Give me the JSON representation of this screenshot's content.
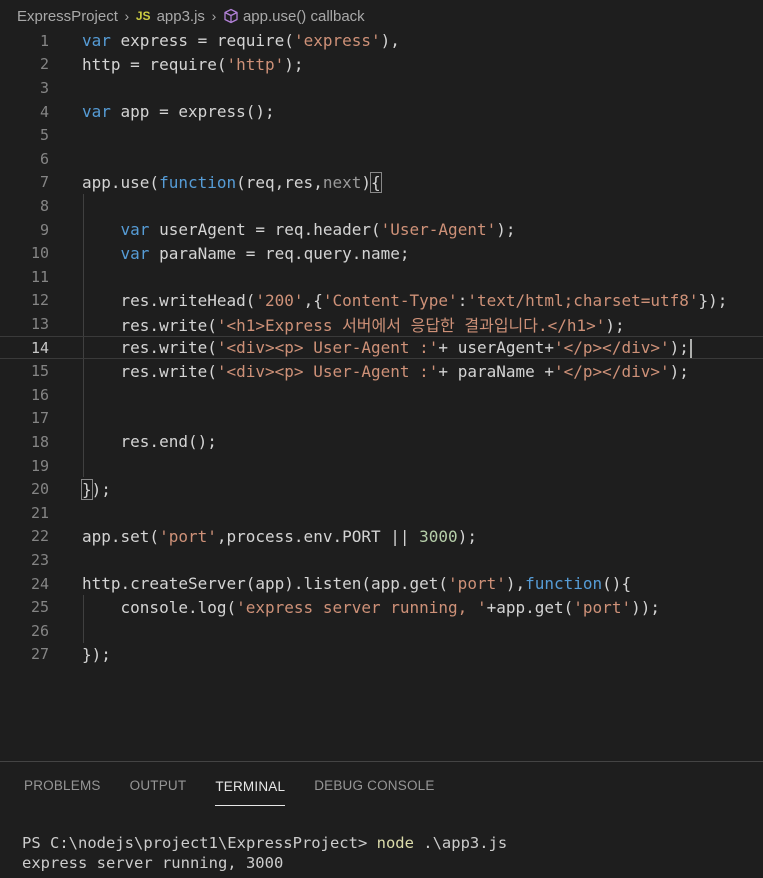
{
  "breadcrumb": {
    "project": "ExpressProject",
    "file_icon": "JS",
    "file": "app3.js",
    "symbol_icon": "cube-icon",
    "symbol": "app.use() callback"
  },
  "editor": {
    "active_line": 14,
    "lines": [
      {
        "n": "1"
      },
      {
        "n": "2"
      },
      {
        "n": "3"
      },
      {
        "n": "4"
      },
      {
        "n": "5"
      },
      {
        "n": "6"
      },
      {
        "n": "7"
      },
      {
        "n": "8"
      },
      {
        "n": "9"
      },
      {
        "n": "10"
      },
      {
        "n": "11"
      },
      {
        "n": "12"
      },
      {
        "n": "13"
      },
      {
        "n": "14"
      },
      {
        "n": "15"
      },
      {
        "n": "16"
      },
      {
        "n": "17"
      },
      {
        "n": "18"
      },
      {
        "n": "19"
      },
      {
        "n": "20"
      },
      {
        "n": "21"
      },
      {
        "n": "22"
      },
      {
        "n": "23"
      },
      {
        "n": "24"
      },
      {
        "n": "25"
      },
      {
        "n": "26"
      },
      {
        "n": "27"
      }
    ],
    "code": [
      [
        [
          "kw",
          "var"
        ],
        [
          "plain",
          " express = require("
        ],
        [
          "str",
          "'express'"
        ],
        [
          "plain",
          "),"
        ]
      ],
      [
        [
          "plain",
          "http = require("
        ],
        [
          "str",
          "'http'"
        ],
        [
          "plain",
          ");"
        ]
      ],
      [],
      [
        [
          "kw",
          "var"
        ],
        [
          "plain",
          " app = express();"
        ]
      ],
      [],
      [],
      [
        [
          "plain",
          "app.use("
        ],
        [
          "kw",
          "function"
        ],
        [
          "plain",
          "(req,res,"
        ],
        [
          "dim",
          "next"
        ],
        [
          "plain",
          ")"
        ],
        [
          "plain",
          "{"
        ]
      ],
      [],
      [
        [
          "plain",
          "    "
        ],
        [
          "kw",
          "var"
        ],
        [
          "plain",
          " userAgent = req.header("
        ],
        [
          "str",
          "'User-Agent'"
        ],
        [
          "plain",
          ");"
        ]
      ],
      [
        [
          "plain",
          "    "
        ],
        [
          "kw",
          "var"
        ],
        [
          "plain",
          " paraName = req.query.name;"
        ]
      ],
      [],
      [
        [
          "plain",
          "    res.writeHead("
        ],
        [
          "str",
          "'200'"
        ],
        [
          "plain",
          ",{"
        ],
        [
          "str",
          "'Content-Type'"
        ],
        [
          "plain",
          ":"
        ],
        [
          "str",
          "'text/html;charset=utf8'"
        ],
        [
          "plain",
          "});"
        ]
      ],
      [
        [
          "plain",
          "    res.write("
        ],
        [
          "str",
          "'<h1>Express 서버에서 응답한 결과입니다.</h1>'"
        ],
        [
          "plain",
          ");"
        ]
      ],
      [
        [
          "plain",
          "    res.write("
        ],
        [
          "str",
          "'<div><p> User-Agent :'"
        ],
        [
          "plain",
          "+ userAgent+"
        ],
        [
          "str",
          "'</p></div>'"
        ],
        [
          "plain",
          ");"
        ]
      ],
      [
        [
          "plain",
          "    res.write("
        ],
        [
          "str",
          "'<div><p> User-Agent :'"
        ],
        [
          "plain",
          "+ paraName +"
        ],
        [
          "str",
          "'</p></div>'"
        ],
        [
          "plain",
          ");"
        ]
      ],
      [],
      [],
      [
        [
          "plain",
          "    res.end();"
        ]
      ],
      [],
      [
        [
          "plain",
          "}"
        ],
        [
          "plain",
          ");"
        ]
      ],
      [],
      [
        [
          "plain",
          "app.set("
        ],
        [
          "str",
          "'port'"
        ],
        [
          "plain",
          ",process.env.PORT || "
        ],
        [
          "num",
          "3000"
        ],
        [
          "plain",
          ");"
        ]
      ],
      [],
      [
        [
          "plain",
          "http.createServer(app).listen(app.get("
        ],
        [
          "str",
          "'port'"
        ],
        [
          "plain",
          "),"
        ],
        [
          "kw",
          "function"
        ],
        [
          "plain",
          "(){"
        ]
      ],
      [
        [
          "plain",
          "    console.log("
        ],
        [
          "str",
          "'express server running, '"
        ],
        [
          "plain",
          "+app.get("
        ],
        [
          "str",
          "'port'"
        ],
        [
          "plain",
          "));"
        ]
      ],
      [],
      [
        [
          "plain",
          "});"
        ]
      ]
    ]
  },
  "panel": {
    "tabs": [
      {
        "label": "PROBLEMS",
        "active": false
      },
      {
        "label": "OUTPUT",
        "active": false
      },
      {
        "label": "TERMINAL",
        "active": true
      },
      {
        "label": "DEBUG CONSOLE",
        "active": false
      }
    ],
    "terminal": {
      "prompt": "PS C:\\nodejs\\project1\\ExpressProject> ",
      "command": "node",
      "args": " .\\app3.js",
      "output": "express server running, 3000"
    }
  }
}
